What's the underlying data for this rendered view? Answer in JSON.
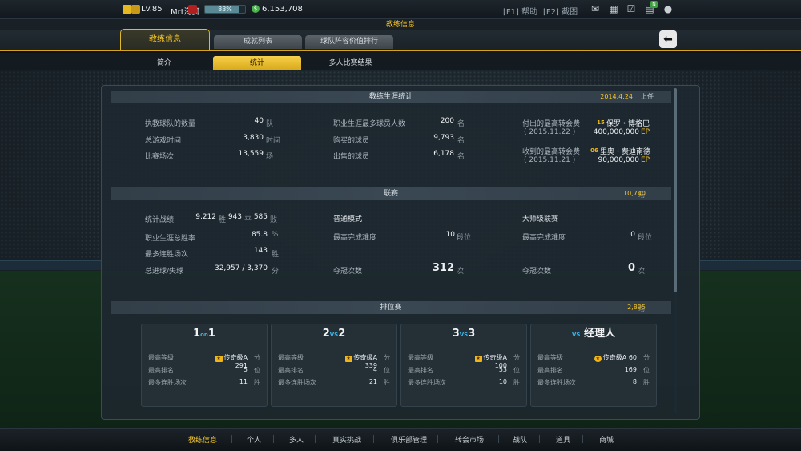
{
  "topbar": {
    "level": "Lv.85",
    "name": "Mrt海狮",
    "exp_percent": "83%",
    "exp_fraction": 0.83,
    "coins": "6,153,708",
    "help": "[F1] 帮助",
    "screenshot": "[F2] 截图"
  },
  "header": {
    "title": "教练信息"
  },
  "tabs": [
    "教练信息",
    "成就列表",
    "球队阵容价值排行"
  ],
  "subtabs": [
    "简介",
    "统计",
    "多人比赛结果"
  ],
  "career": {
    "title": "教练生涯统计",
    "date": "2014.4.24",
    "date_suffix": "上任",
    "col1": [
      {
        "label": "执教球队的数量",
        "value": "40",
        "unit": "队"
      },
      {
        "label": "总游戏时间",
        "value": "3,830",
        "unit": "时间"
      },
      {
        "label": "比赛场次",
        "value": "13,559",
        "unit": "场"
      }
    ],
    "col2": [
      {
        "label": "职业生涯最多球员人数",
        "value": "200",
        "unit": "名"
      },
      {
        "label": "购买的球员",
        "value": "9,793",
        "unit": "名"
      },
      {
        "label": "出售的球员",
        "value": "6,178",
        "unit": "名"
      }
    ],
    "transfers": [
      {
        "label": "付出的最高转会费",
        "date": "( 2015.11.22 )",
        "badge": "15",
        "player": "保罗・博格巴",
        "amount": "400,000,000",
        "currency": "EP"
      },
      {
        "label": "收到的最高转会费",
        "date": "( 2015.11.21 )",
        "badge": "06",
        "player": "里奥・费迪南德",
        "amount": "90,000,000",
        "currency": "EP"
      }
    ]
  },
  "league": {
    "title": "联赛",
    "total": "10,740",
    "total_unit": "场",
    "record_label": "统计战绩",
    "wins": "9,212",
    "wins_unit": "胜",
    "draws": "943",
    "draws_unit": "平",
    "losses": "585",
    "losses_unit": "败",
    "win_rate_label": "职业生涯总胜率",
    "win_rate": "85.8",
    "win_rate_unit": "%",
    "streak_label": "最多连胜场次",
    "streak": "143",
    "streak_unit": "胜",
    "goals_label": "总进球/失球",
    "goals": "32,957 / 3,370",
    "goals_unit": "分",
    "normal": {
      "title": "普通模式",
      "difficulty_label": "最高完成难度",
      "difficulty": "10",
      "difficulty_unit": "段位",
      "titles_label": "夺冠次数",
      "titles": "312",
      "titles_unit": "次"
    },
    "master": {
      "title": "大师级联赛",
      "difficulty_label": "最高完成难度",
      "difficulty": "0",
      "difficulty_unit": "段位",
      "titles_label": "夺冠次数",
      "titles": "0",
      "titles_unit": "次"
    }
  },
  "ranked": {
    "title": "排位赛",
    "total": "2,895",
    "total_unit": "场",
    "row_labels": [
      "最高等级",
      "最高排名",
      "最多连胜场次"
    ],
    "cards": [
      {
        "left": "1",
        "vs": "on",
        "right": "1",
        "tier": "传奇级A",
        "points": "291",
        "points_unit": "分",
        "rank": "5",
        "rank_unit": "位",
        "streak": "11",
        "streak_unit": "胜"
      },
      {
        "left": "2",
        "vs": "VS",
        "right": "2",
        "tier": "传奇级A",
        "points": "339",
        "points_unit": "分",
        "rank": "4",
        "rank_unit": "位",
        "streak": "21",
        "streak_unit": "胜"
      },
      {
        "left": "3",
        "vs": "VS",
        "right": "3",
        "tier": "传奇级A",
        "points": "100",
        "points_unit": "分",
        "rank": "53",
        "rank_unit": "位",
        "streak": "10",
        "streak_unit": "胜"
      },
      {
        "left": "",
        "vs": "VS",
        "right": "经理人",
        "tier": "传奇级A",
        "points": "60",
        "points_unit": "分",
        "rank": "169",
        "rank_unit": "位",
        "streak": "8",
        "streak_unit": "胜"
      }
    ]
  },
  "bottom_nav": [
    "教练信息",
    "个人",
    "多人",
    "真实挑战",
    "俱乐部管理",
    "转会市场",
    "战队",
    "道具",
    "商城"
  ],
  "colors": {
    "accent": "#f4c62a",
    "ep": "#ffc018",
    "vs": "#3ab4e8"
  }
}
